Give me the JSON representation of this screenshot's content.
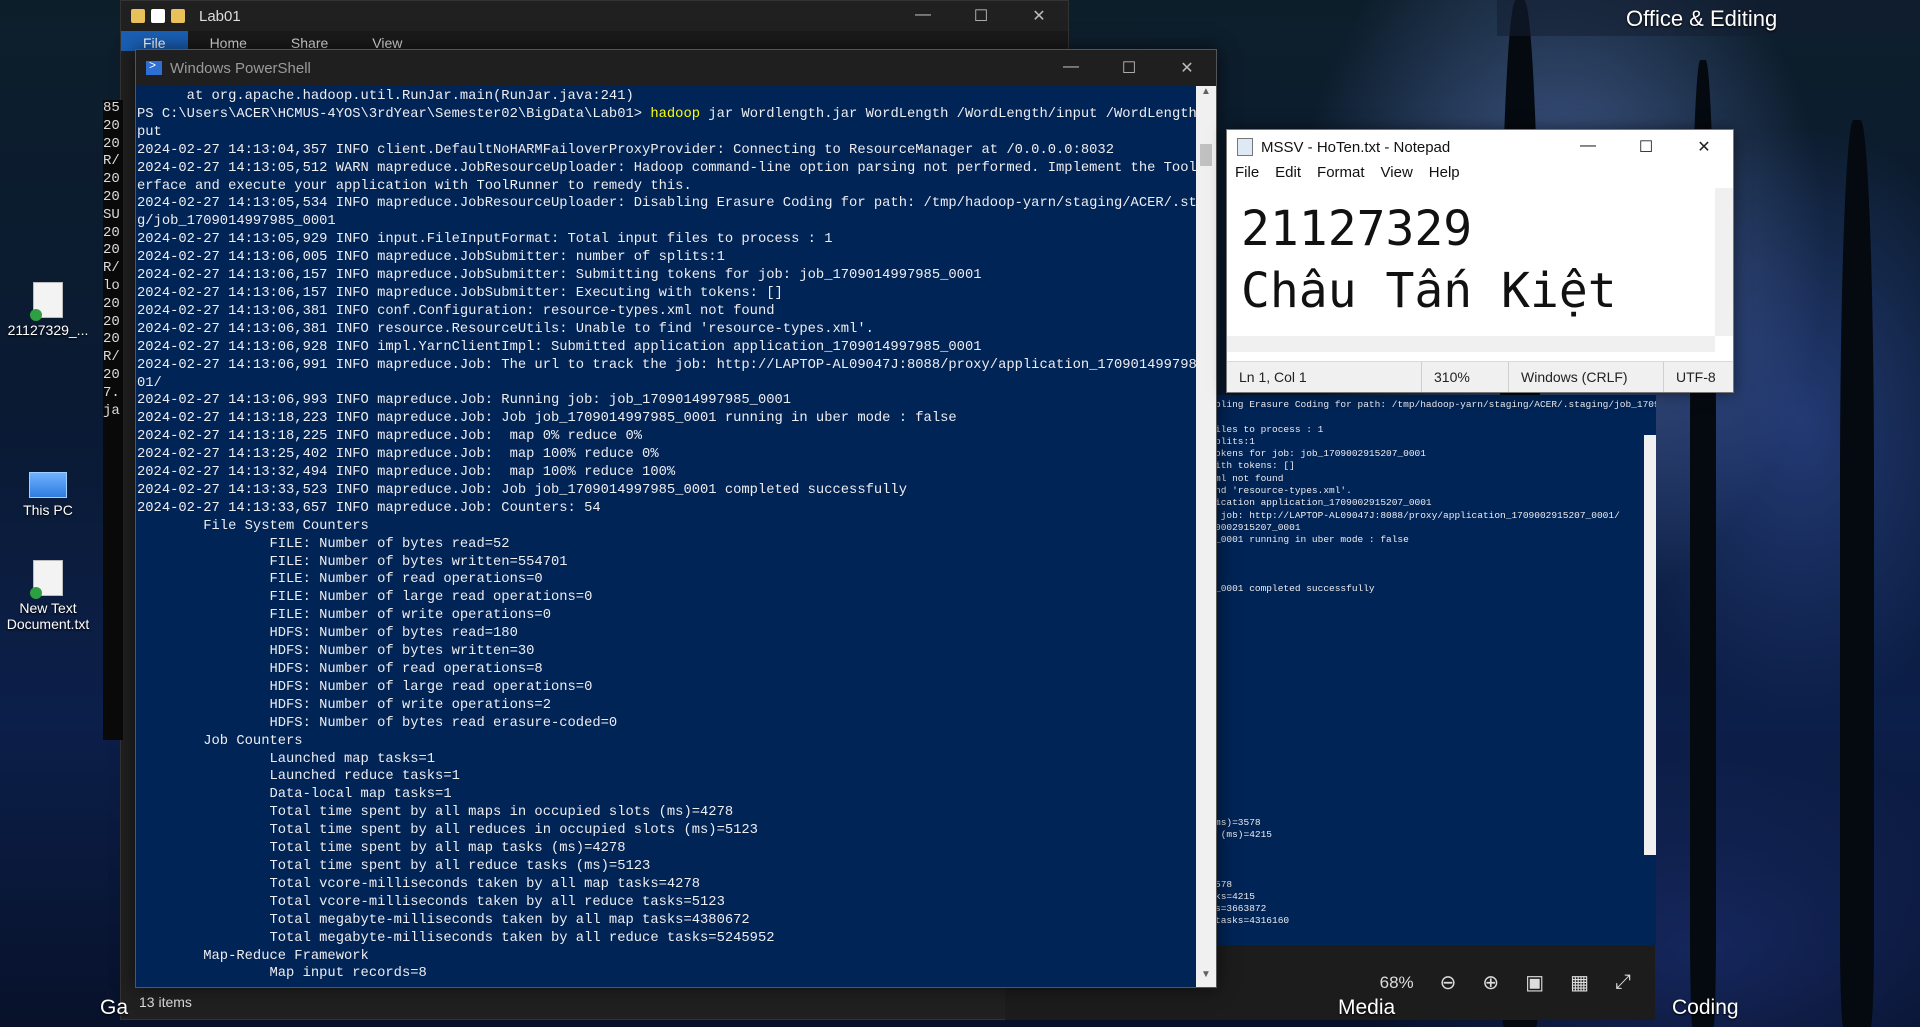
{
  "desktop": {
    "group_top": "Office & Editing",
    "group_media": "Media",
    "group_coding": "Coding",
    "group_ga": "Ga",
    "icons": [
      {
        "label": "21127329_..."
      },
      {
        "label": "This PC"
      },
      {
        "label": "New Text Document.txt"
      }
    ]
  },
  "explorer": {
    "title": "Lab01",
    "ribbon": [
      "File",
      "Home",
      "Share",
      "View"
    ],
    "status": "13 items",
    "left_fragments": "85\n20\n20\nR/\n20\n20\nSU\n20\n20\nR/\nlo\n20\n20\n20\nR/\n20\n7.\nja"
  },
  "powershell": {
    "title": "Windows PowerShell",
    "prompt_pre": "      at org.apache.hadoop.util.RunJar.main(RunJar.java:241)\nPS C:\\Users\\ACER\\HCMUS-4YOS\\3rdYear\\Semester02\\BigData\\Lab01> ",
    "command_name": "hadoop",
    "command_args": " jar Wordlength.jar WordLength /WordLength/input /WordLength/out\nput",
    "output": "2024-02-27 14:13:04,357 INFO client.DefaultNoHARMFailoverProxyProvider: Connecting to ResourceManager at /0.0.0.0:8032\n2024-02-27 14:13:05,512 WARN mapreduce.JobResourceUploader: Hadoop command-line option parsing not performed. Implement the Tool int\nerface and execute your application with ToolRunner to remedy this.\n2024-02-27 14:13:05,534 INFO mapreduce.JobResourceUploader: Disabling Erasure Coding for path: /tmp/hadoop-yarn/staging/ACER/.stagin\ng/job_1709014997985_0001\n2024-02-27 14:13:05,929 INFO input.FileInputFormat: Total input files to process : 1\n2024-02-27 14:13:06,005 INFO mapreduce.JobSubmitter: number of splits:1\n2024-02-27 14:13:06,157 INFO mapreduce.JobSubmitter: Submitting tokens for job: job_1709014997985_0001\n2024-02-27 14:13:06,157 INFO mapreduce.JobSubmitter: Executing with tokens: []\n2024-02-27 14:13:06,381 INFO conf.Configuration: resource-types.xml not found\n2024-02-27 14:13:06,381 INFO resource.ResourceUtils: Unable to find 'resource-types.xml'.\n2024-02-27 14:13:06,928 INFO impl.YarnClientImpl: Submitted application application_1709014997985_0001\n2024-02-27 14:13:06,991 INFO mapreduce.Job: The url to track the job: http://LAPTOP-AL09047J:8088/proxy/application_1709014997985_00\n01/\n2024-02-27 14:13:06,993 INFO mapreduce.Job: Running job: job_1709014997985_0001\n2024-02-27 14:13:18,223 INFO mapreduce.Job: Job job_1709014997985_0001 running in uber mode : false\n2024-02-27 14:13:18,225 INFO mapreduce.Job:  map 0% reduce 0%\n2024-02-27 14:13:25,402 INFO mapreduce.Job:  map 100% reduce 0%\n2024-02-27 14:13:32,494 INFO mapreduce.Job:  map 100% reduce 100%\n2024-02-27 14:13:33,523 INFO mapreduce.Job: Job job_1709014997985_0001 completed successfully\n2024-02-27 14:13:33,657 INFO mapreduce.Job: Counters: 54\n        File System Counters\n                FILE: Number of bytes read=52\n                FILE: Number of bytes written=554701\n                FILE: Number of read operations=0\n                FILE: Number of large read operations=0\n                FILE: Number of write operations=0\n                HDFS: Number of bytes read=180\n                HDFS: Number of bytes written=30\n                HDFS: Number of read operations=8\n                HDFS: Number of large read operations=0\n                HDFS: Number of write operations=2\n                HDFS: Number of bytes read erasure-coded=0\n        Job Counters\n                Launched map tasks=1\n                Launched reduce tasks=1\n                Data-local map tasks=1\n                Total time spent by all maps in occupied slots (ms)=4278\n                Total time spent by all reduces in occupied slots (ms)=5123\n                Total time spent by all map tasks (ms)=4278\n                Total time spent by all reduce tasks (ms)=5123\n                Total vcore-milliseconds taken by all map tasks=4278\n                Total vcore-milliseconds taken by all reduce tasks=5123\n                Total megabyte-milliseconds taken by all map tasks=4380672\n                Total megabyte-milliseconds taken by all reduce tasks=5245952\n        Map-Reduce Framework\n                Map input records=8"
  },
  "background_terminal": {
    "text": "bling Erasure Coding for path: /tmp/hadoop-yarn/staging/ACER/.staging/job_170900\n\niles to process : 1\nplits:1\nokens for job: job_1709002915207_0001\nith tokens: []\nml not found\nnd 'resource-types.xml'.\nication application_1709002915207_0001\n job: http://LAPTOP-AL09047J:8088/proxy/application_1709002915207_0001/\n0002915207_0001\n_0001 running in uber mode : false\n\n\n\n_0001 completed successfully\n\n\n\n\n\n\n\n\n\n\n\n\n\n\n\n\n\n\nms)=3578\n (ms)=4215\n\n\n\n578\nks=4215\ns=3663872\ntasks=4316160"
  },
  "photos": {
    "zoom": "68%"
  },
  "notepad": {
    "title": "MSSV - HoTen.txt - Notepad",
    "menu": [
      "File",
      "Edit",
      "Format",
      "View",
      "Help"
    ],
    "content": "21127329\nChâu Tấn Kiệt",
    "status_position": "Ln 1, Col 1",
    "status_zoom": "310%",
    "status_eol": "Windows (CRLF)",
    "status_encoding": "UTF-8"
  }
}
